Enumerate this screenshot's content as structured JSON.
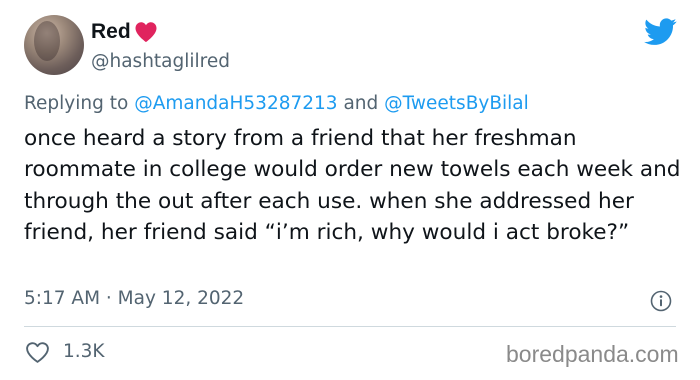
{
  "author": {
    "name": "Red",
    "handle": "@hashtaglilred"
  },
  "reply": {
    "prefix": "Replying to ",
    "mention1": "@AmandaH53287213",
    "conjunction": " and ",
    "mention2": "@TweetsByBilal"
  },
  "tweet": {
    "text": "once heard a story from a friend that her freshman roommate in college would order new towels each week and through the out after each use. when she addressed her friend, her friend said “i’m rich, why would i act broke?”",
    "timestamp": "5:17 AM · May 12, 2022"
  },
  "stats": {
    "likes": "1.3K"
  },
  "watermark": "boredpanda.com",
  "icons": {
    "heart": "heart-emoji-icon",
    "brand": "twitter-bird-icon",
    "info": "info-icon",
    "like": "like-heart-outline-icon"
  },
  "colors": {
    "twitter_blue": "#1d9bf0",
    "heart_red": "#e0245e",
    "secondary_text": "#536471"
  }
}
